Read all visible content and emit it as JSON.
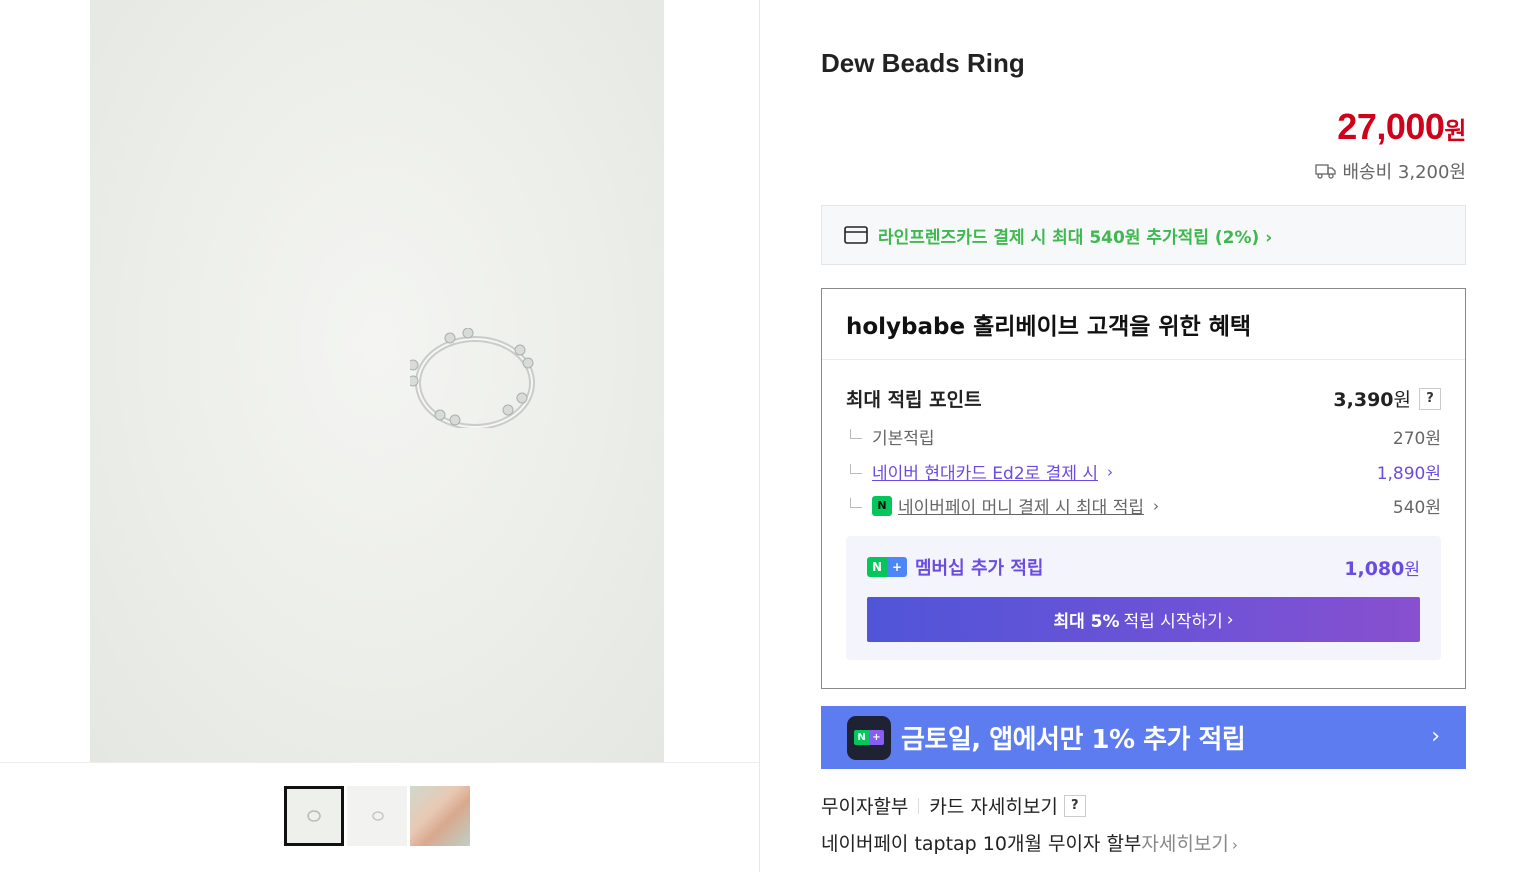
{
  "product": {
    "title": "Dew Beads Ring",
    "price_number": "27,000",
    "price_unit": "원",
    "shipping_text": "배송비 3,200원"
  },
  "card_banner": {
    "text": "라인프렌즈카드 결제 시 최대 540원 추가적립 (2%)",
    "chevron": "›"
  },
  "benefit": {
    "heading": "holybabe 홀리베이브 고객을 위한 혜택",
    "max_points_label": "최대 적립 포인트",
    "max_points_value": "3,390",
    "won": "원",
    "help": "?",
    "items": [
      {
        "label": "기본적립",
        "value": "270원"
      },
      {
        "label": "네이버 현대카드 Ed2로 결제 시",
        "value": "1,890원"
      },
      {
        "label": "네이버페이 머니 결제 시 최대 적립",
        "value": "540원"
      }
    ],
    "npay_badge": "N",
    "membership": {
      "badge_n": "N",
      "badge_plus": "+",
      "label": "멤버십 추가 적립",
      "value": "1,080",
      "unit": "원",
      "button_bold": "최대 5%",
      "button_rest": "적립 시작하기",
      "button_chevron": "›"
    }
  },
  "promo": {
    "icon_n": "N",
    "icon_plus": "+",
    "text": "금토일, 앱에서만 1% 추가 적립",
    "arrow": "›"
  },
  "installment": {
    "label": "무이자할부",
    "details": "카드 자세히보기",
    "help": "?",
    "line2": "네이버페이 taptap 10개월 무이자 할부",
    "line2_more": "자세히보기",
    "chevron": "›"
  },
  "colors": {
    "price": "#d0021b",
    "card_green": "#3fb84f",
    "naver_purple": "#6a4de0",
    "promo_blue": "#5c7cf0"
  },
  "icons": [
    "truck-icon",
    "credit-card-icon",
    "npay-icon",
    "nplus-icon",
    "chevron-right-icon",
    "help-icon"
  ]
}
